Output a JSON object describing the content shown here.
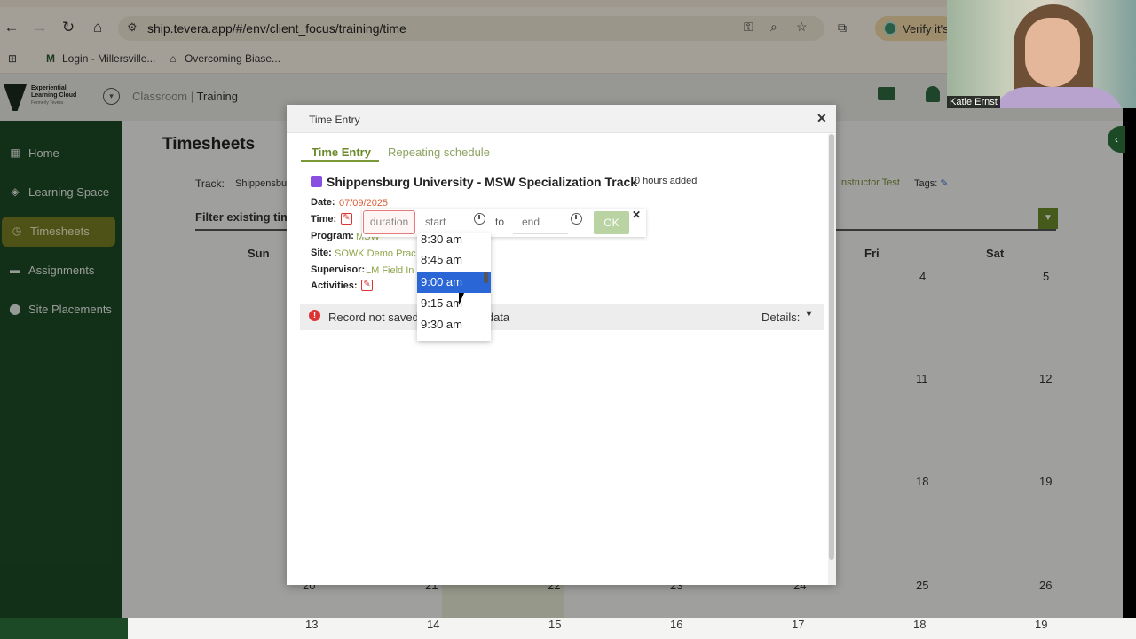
{
  "browser": {
    "url": "ship.tevera.app/#/env/client_focus/training/time",
    "verify_label": "Verify it's",
    "bookmarks": [
      {
        "icon": "M",
        "label": "Login - Millersville..."
      },
      {
        "icon": "⌂",
        "label": "Overcoming Biase..."
      }
    ]
  },
  "app": {
    "logo_lines": [
      "Experiential",
      "Learning Cloud"
    ],
    "logo_sub": "Formerly Tevera",
    "crumb_first": "Classroom",
    "crumb_sep": "|",
    "crumb_current": "Training"
  },
  "sidebar": {
    "items": [
      {
        "label": "Home"
      },
      {
        "label": "Learning Space"
      },
      {
        "label": "Timesheets"
      },
      {
        "label": "Assignments"
      },
      {
        "label": "Site Placements"
      }
    ]
  },
  "page": {
    "title": "Timesheets",
    "track_label": "Track:",
    "track_value": "Shippensbu",
    "instructor": "Instructor Test",
    "tags_label": "Tags:",
    "filter_label": "Filter existing time",
    "days": [
      "Sun",
      "Fri",
      "Sat"
    ],
    "week_numbers": {
      "row1": [
        "4",
        "5"
      ],
      "row2": [
        "11",
        "12"
      ],
      "row3": [
        "18",
        "19"
      ],
      "row4": [
        "20",
        "21",
        "22",
        "23",
        "24",
        "25",
        "26"
      ],
      "bottom": [
        "13",
        "14",
        "15",
        "16",
        "17",
        "18",
        "19"
      ]
    }
  },
  "modal": {
    "title": "Time Entry",
    "tabs": [
      "Time Entry",
      "Repeating schedule"
    ],
    "track_name": "Shippensburg University - MSW Specialization Track",
    "hours_added": "0 hours added",
    "date_label": "Date:",
    "date_value": "07/09/2025",
    "time_label": "Time:",
    "program_label": "Program:",
    "program_value": "MSW",
    "site_label": "Site:",
    "site_value": "SOWK Demo Prac",
    "supervisor_label": "Supervisor:",
    "supervisor_value": "LM Field In",
    "activities_label": "Activities:",
    "duration_placeholder": "duration",
    "start_placeholder": "start",
    "to_label": "to",
    "end_placeholder": "end",
    "ok_label": "OK",
    "status_text": "Record not saved:",
    "status_tail": "d data",
    "details_label": "Details:"
  },
  "time_options": {
    "items": [
      "8:30 am",
      "8:45 am",
      "9:00 am",
      "9:15 am",
      "9:30 am"
    ],
    "selected": "9:00 am"
  },
  "video": {
    "participant": "Katie Ernst"
  },
  "colors": {
    "sidebar": "#1d4a26",
    "accent": "#6a8a2a",
    "selected_option": "#2a66d6",
    "error": "#dd3333",
    "track_swatch": "#8a4fe0"
  }
}
